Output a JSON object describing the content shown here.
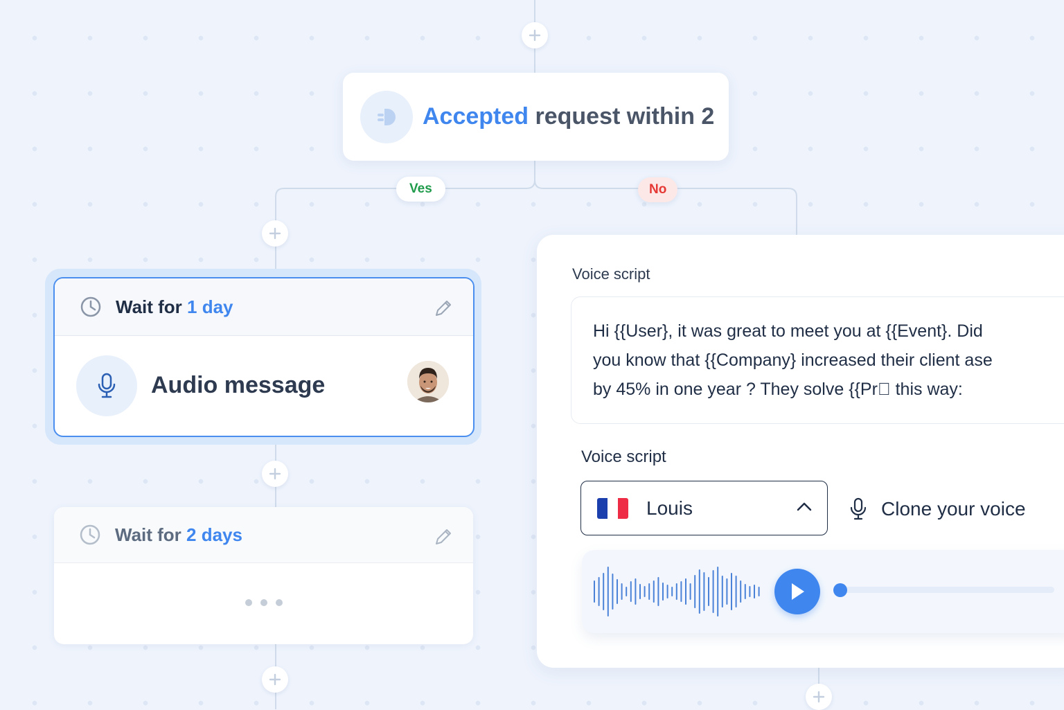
{
  "trigger": {
    "highlight": "Accepted",
    "rest": " request within 2"
  },
  "branches": {
    "yes_label": "Ves",
    "no_label": "No"
  },
  "step1": {
    "wait_prefix": "Wait for ",
    "wait_value": "1 day",
    "action_label": "Audio message"
  },
  "step2": {
    "wait_prefix": "Wait for ",
    "wait_value": "2 days"
  },
  "voice_panel": {
    "script_label": "Voice script",
    "script_lines": [
      "Hi {{User}, it was great to meet you at  {{Event}. Did",
      "you know that {{Company} increased their client ase",
      "by 45% in one year ? They solve {{Pr\u0000  this way:"
    ],
    "voice_label": "Voice script",
    "voice_selected": "Louis",
    "clone_label": "Clone your voice"
  },
  "colors": {
    "accent": "#3f86ee",
    "yes": "#1f9b4b",
    "no": "#e53935",
    "flag": [
      "#1c3fae",
      "#ffffff",
      "#ee2c45"
    ]
  },
  "icons": {
    "trigger": "linkedin-connect-icon",
    "wait": "clock-icon",
    "edit": "pencil-icon",
    "audio": "microphone-icon",
    "play": "play-icon",
    "plus": "plus-icon",
    "chevron": "chevron-up-icon"
  }
}
